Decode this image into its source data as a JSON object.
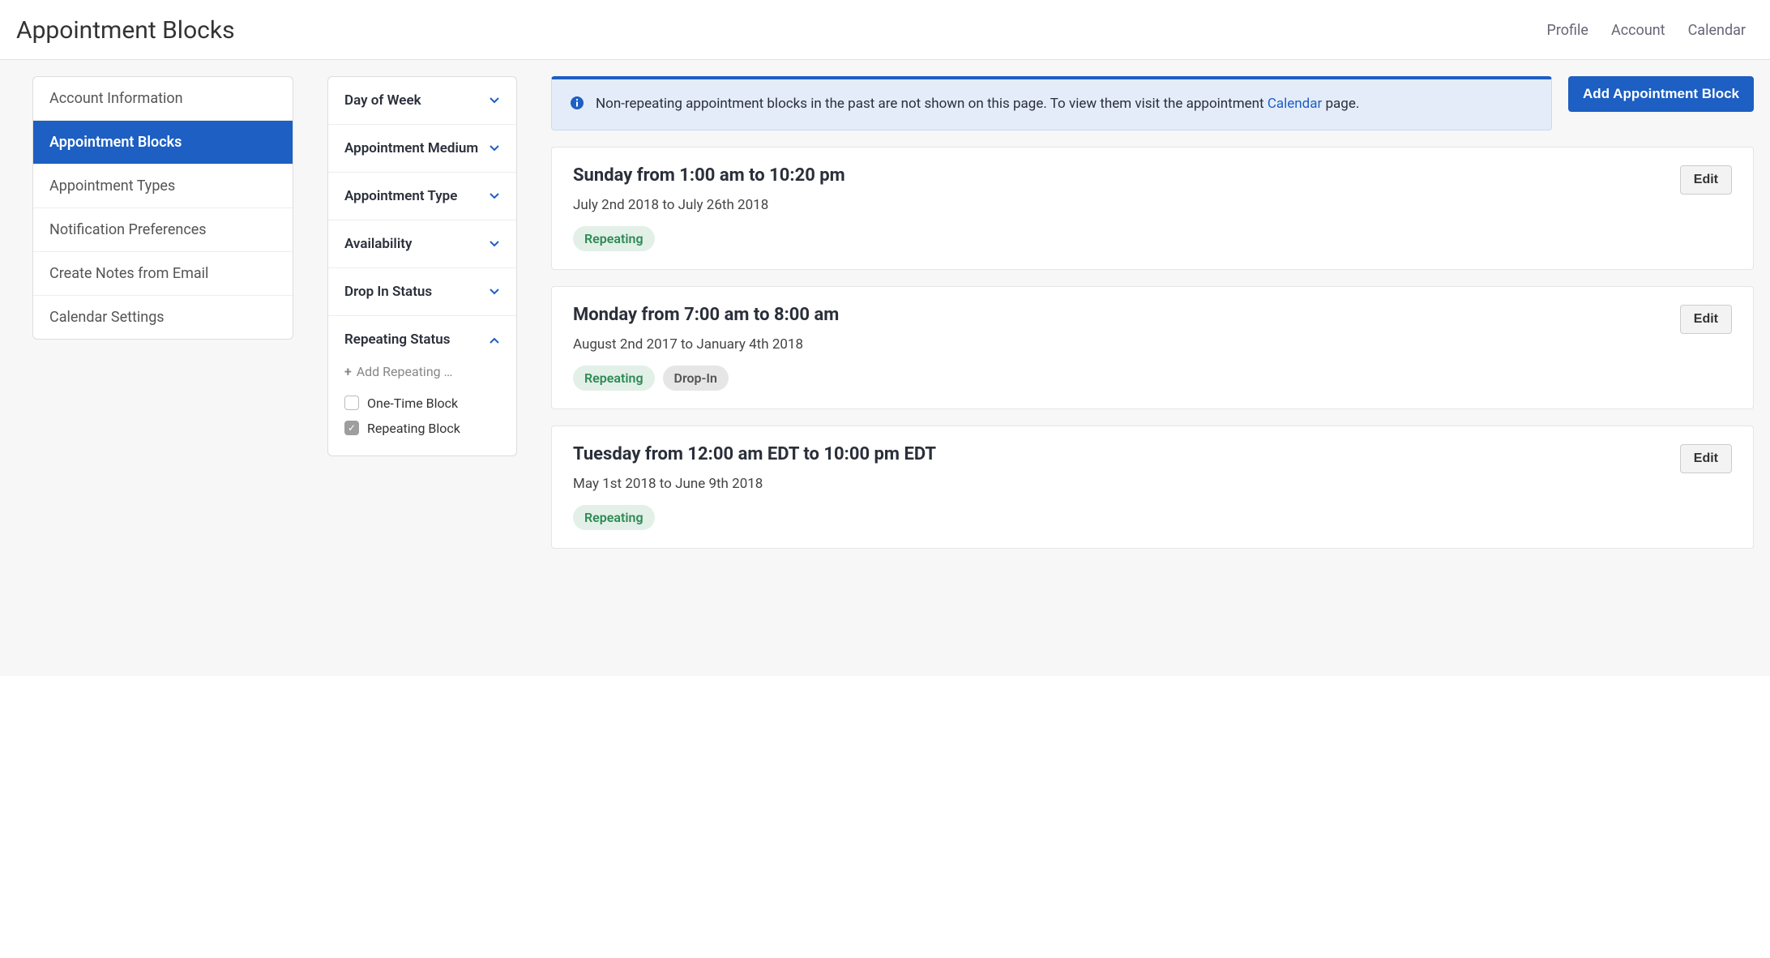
{
  "header": {
    "title": "Appointment Blocks",
    "nav": {
      "profile": "Profile",
      "account": "Account",
      "calendar": "Calendar"
    }
  },
  "sidebar": {
    "items": [
      {
        "label": "Account Information",
        "active": false
      },
      {
        "label": "Appointment Blocks",
        "active": true
      },
      {
        "label": "Appointment Types",
        "active": false
      },
      {
        "label": "Notification Preferences",
        "active": false
      },
      {
        "label": "Create Notes from Email",
        "active": false
      },
      {
        "label": "Calendar Settings",
        "active": false
      }
    ]
  },
  "filters": {
    "sections": [
      {
        "label": "Day of Week",
        "expanded": false
      },
      {
        "label": "Appointment Medium",
        "expanded": false
      },
      {
        "label": "Appointment Type",
        "expanded": false
      },
      {
        "label": "Availability",
        "expanded": false
      },
      {
        "label": "Drop In Status",
        "expanded": false
      },
      {
        "label": "Repeating Status",
        "expanded": true,
        "add_label": "Add Repeating …",
        "options": [
          {
            "label": "One-Time Block",
            "checked": false
          },
          {
            "label": "Repeating Block",
            "checked": true
          }
        ]
      }
    ]
  },
  "banner": {
    "text_before": "Non-repeating appointment blocks in the past are not shown on this page. To view them visit the appointment ",
    "link_text": "Calendar",
    "text_after": " page."
  },
  "actions": {
    "add_block": "Add Appointment Block",
    "edit": "Edit"
  },
  "tags": {
    "repeating": "Repeating",
    "dropin": "Drop-In"
  },
  "blocks": [
    {
      "title": "Sunday from 1:00 am to 10:20 pm",
      "range": "July 2nd 2018 to July 26th 2018",
      "tags": [
        "repeating"
      ]
    },
    {
      "title": "Monday from 7:00 am to 8:00 am",
      "range": "August 2nd 2017 to January 4th 2018",
      "tags": [
        "repeating",
        "dropin"
      ]
    },
    {
      "title": "Tuesday from 12:00 am EDT to 10:00 pm EDT",
      "range": "May 1st 2018 to June 9th 2018",
      "tags": [
        "repeating"
      ]
    }
  ]
}
